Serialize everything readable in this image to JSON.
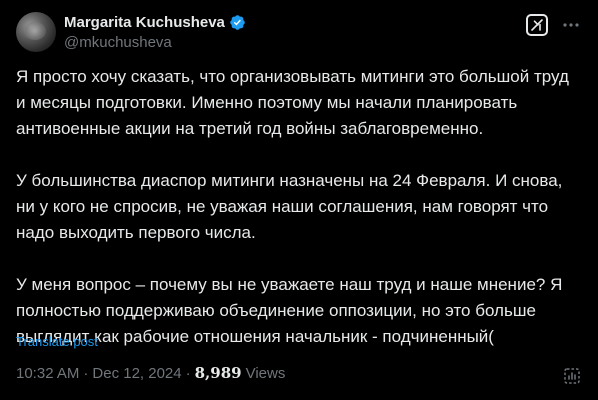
{
  "author": {
    "display_name": "Margarita Kuchusheva",
    "handle": "@mkuchusheva"
  },
  "post": {
    "paragraphs": [
      "Я просто хочу сказать, что организовывать митинги это большой труд и месяцы подготовки. Именно поэтому мы начали планировать антивоенные акции на третий год войны заблаговременно.",
      "У большинства диаспор митинги назначены на 24 Февраля. И снова, ни у кого не спросив, не уважая наши соглашения, нам говорят что надо выходить первого числа.",
      "У меня вопрос – почему вы не уважаете наш труд и наше мнение? Я полностью поддерживаю объединение оппозиции, но это больше выглядит как рабочие отношения начальник - подчиненный("
    ],
    "translate_label": "Translate post"
  },
  "meta": {
    "time": "10:32 AM",
    "separator": "·",
    "date": "Dec 12, 2024",
    "dot": "·",
    "views_count": "8,989",
    "views_label": "Views"
  },
  "icons": {
    "verified": "verified-badge-icon",
    "grok": "grok-icon",
    "more": "more-options-icon",
    "stats": "post-analytics-icon"
  },
  "colors": {
    "background": "#000000",
    "text": "#e7e9ea",
    "muted": "#71767b",
    "accent": "#1d9bf0"
  }
}
